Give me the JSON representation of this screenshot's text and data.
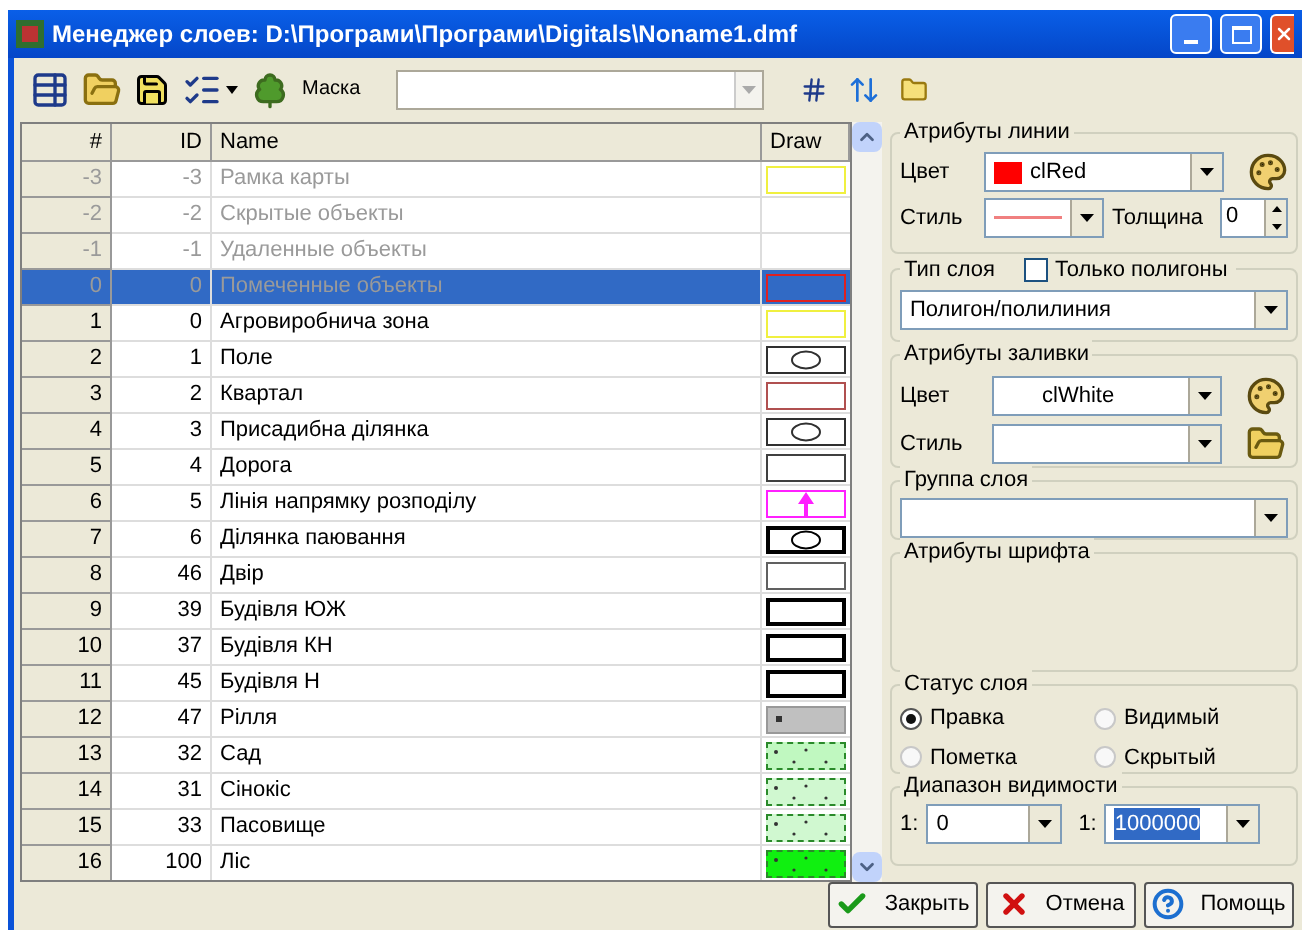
{
  "window": {
    "title": "Менеджер слоев: D:\\Програми\\Програми\\Digitals\\Noname1.dmf"
  },
  "toolbar": {
    "mask_label": "Маска"
  },
  "table": {
    "columns": [
      "#",
      "ID",
      "Name",
      "Draw"
    ],
    "rows": [
      {
        "num": "-3",
        "id": "-3",
        "name": "Рамка карты",
        "dimmed": true,
        "selected": false,
        "swatch": {
          "kind": "outline",
          "color": "#f0f040"
        }
      },
      {
        "num": "-2",
        "id": "-2",
        "name": "Скрытые объекты",
        "dimmed": true,
        "selected": false,
        "swatch": {
          "kind": "blank"
        }
      },
      {
        "num": "-1",
        "id": "-1",
        "name": "Удаленные объекты",
        "dimmed": true,
        "selected": false,
        "swatch": {
          "kind": "blank"
        }
      },
      {
        "num": "0",
        "id": "0",
        "name": "Помеченные объекты",
        "dimmed": true,
        "selected": true,
        "swatch": {
          "kind": "outline",
          "color": "#e02020"
        }
      },
      {
        "num": "1",
        "id": "0",
        "name": "Агровиробнича зона",
        "dimmed": false,
        "selected": false,
        "swatch": {
          "kind": "outline",
          "color": "#f0f040"
        }
      },
      {
        "num": "2",
        "id": "1",
        "name": "Поле",
        "dimmed": false,
        "selected": false,
        "swatch": {
          "kind": "circle",
          "color": "#303030"
        }
      },
      {
        "num": "3",
        "id": "2",
        "name": "Квартал",
        "dimmed": false,
        "selected": false,
        "swatch": {
          "kind": "outline",
          "color": "#b05050"
        }
      },
      {
        "num": "4",
        "id": "3",
        "name": "Присадибна ділянка",
        "dimmed": false,
        "selected": false,
        "swatch": {
          "kind": "circle",
          "color": "#303030"
        }
      },
      {
        "num": "5",
        "id": "4",
        "name": "Дорога",
        "dimmed": false,
        "selected": false,
        "swatch": {
          "kind": "outline",
          "color": "#404040"
        }
      },
      {
        "num": "6",
        "id": "5",
        "name": "Лінія напрямку розподілу",
        "dimmed": false,
        "selected": false,
        "swatch": {
          "kind": "arrow",
          "color": "#ff20ff"
        }
      },
      {
        "num": "7",
        "id": "6",
        "name": "Ділянка паювання",
        "dimmed": false,
        "selected": false,
        "swatch": {
          "kind": "bold-circle",
          "color": "#000000"
        }
      },
      {
        "num": "8",
        "id": "46",
        "name": "Двір",
        "dimmed": false,
        "selected": false,
        "swatch": {
          "kind": "outline",
          "color": "#606060"
        }
      },
      {
        "num": "9",
        "id": "39",
        "name": "Будівля ЮЖ",
        "dimmed": false,
        "selected": false,
        "swatch": {
          "kind": "bold-outline",
          "color": "#000000"
        }
      },
      {
        "num": "10",
        "id": "37",
        "name": "Будівля КН",
        "dimmed": false,
        "selected": false,
        "swatch": {
          "kind": "bold-outline",
          "color": "#000000"
        }
      },
      {
        "num": "11",
        "id": "45",
        "name": "Будівля Н",
        "dimmed": false,
        "selected": false,
        "swatch": {
          "kind": "bold-outline",
          "color": "#000000"
        }
      },
      {
        "num": "12",
        "id": "47",
        "name": "Рілля",
        "dimmed": false,
        "selected": false,
        "swatch": {
          "kind": "fill",
          "color": "#c0c0c0"
        }
      },
      {
        "num": "13",
        "id": "32",
        "name": "Сад",
        "dimmed": false,
        "selected": false,
        "swatch": {
          "kind": "hatched",
          "color": "#c0f8c0"
        }
      },
      {
        "num": "14",
        "id": "31",
        "name": "Сінокіс",
        "dimmed": false,
        "selected": false,
        "swatch": {
          "kind": "hatched",
          "color": "#d0f8d0"
        }
      },
      {
        "num": "15",
        "id": "33",
        "name": "Пасовище",
        "dimmed": false,
        "selected": false,
        "swatch": {
          "kind": "hatched",
          "color": "#d0f8d0"
        }
      },
      {
        "num": "16",
        "id": "100",
        "name": "Ліс",
        "dimmed": false,
        "selected": false,
        "swatch": {
          "kind": "hatched",
          "color": "#10f010"
        }
      }
    ]
  },
  "line_attributes": {
    "title": "Атрибуты линии",
    "color_label": "Цвет",
    "color_value": "clRed",
    "style_label": "Стиль",
    "thickness_label": "Толщина",
    "thickness_value": "0"
  },
  "layer_type": {
    "title": "Тип слоя",
    "polygons_only_label": "Только полигоны",
    "polygons_only_checked": false,
    "value": "Полигон/полилиния"
  },
  "fill_attributes": {
    "title": "Атрибуты заливки",
    "color_label": "Цвет",
    "color_value": "clWhite",
    "style_label": "Стиль"
  },
  "layer_group": {
    "title": "Группа слоя"
  },
  "font_attributes": {
    "title": "Атрибуты шрифта"
  },
  "layer_status": {
    "title": "Статус слоя",
    "options": [
      {
        "label": "Правка",
        "selected": true
      },
      {
        "label": "Видимый",
        "selected": false
      },
      {
        "label": "Пометка",
        "selected": false
      },
      {
        "label": "Скрытый",
        "selected": false
      }
    ]
  },
  "visibility_range": {
    "title": "Диапазон видимости",
    "from_prefix": "1:",
    "from_value": "0",
    "to_prefix": "1:",
    "to_value": "1000000"
  },
  "buttons": [
    {
      "label": "Закрыть",
      "kind": "close"
    },
    {
      "label": "Отмена",
      "kind": "cancel"
    },
    {
      "label": "Помощь",
      "kind": "help"
    }
  ]
}
